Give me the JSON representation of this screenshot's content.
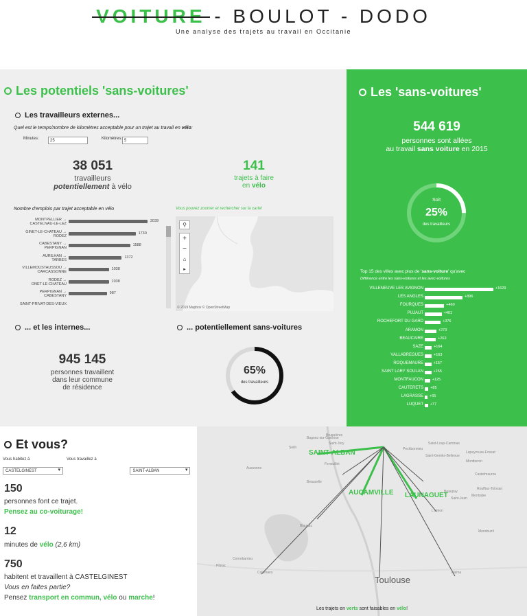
{
  "header": {
    "title_part1": "VOITURE",
    "title_part2": " - BOULOT - DODO",
    "subtitle": "Une analyse des trajets au travail en Occitanie"
  },
  "left": {
    "title": "Les potentiels 'sans-voitures'",
    "externes": {
      "title": "Les travailleurs externes...",
      "question_pre": "Quel est le temps/nombre de kilomètres acceptable pour un trajet au travail en ",
      "question_bold": "vélo",
      "question_post": ":",
      "minutes_label": "Minutes:",
      "minutes_value": "25",
      "km_label": "Kilomètres:",
      "km_value": "5",
      "workers_number": "38 051",
      "workers_l1": "travailleurs",
      "workers_l2_bold": "potentiellement",
      "workers_l2_rest": " à vélo",
      "trips_number": "141",
      "trips_l1": "trajets à faire",
      "trips_l2_pre": "en ",
      "trips_l2_bold": "vélo",
      "chart_title": "Nombre d'emplois par trajet acceptable en vélo",
      "map_hint": "Vous pouvez zoomer et rechercher sur la carte!",
      "map_credit": "© 2019 Mapbox © OpenStreetMap"
    },
    "internes": {
      "title": "... et les internes...",
      "number": "945 145",
      "l1": "personnes travaillent",
      "l2": "dans leur commune",
      "l3": "de résidence"
    },
    "potentiel": {
      "title": "... potentiellement sans-voitures",
      "pct": "65%",
      "sub": "des travailleurs"
    }
  },
  "right": {
    "title": "Les 'sans-voitures'",
    "number": "544 619",
    "l1": "personnes sont allées",
    "l2_pre": "au travail ",
    "l2_bold": "sans voiture",
    "l2_post": " en 2015",
    "donut_soit": "Soit",
    "donut_pct": "25%",
    "donut_sub": "des travailleurs",
    "top_title_pre": "Top 15 des villes avec plus de '",
    "top_title_bold": "sans-voiture",
    "top_title_post": "' qu'avec",
    "top_sub": "Différence entre les sans-voitures et les avec-voitures"
  },
  "bottom": {
    "title": "Et vous?",
    "habitez_label": "Vous habitez à",
    "habitez_value": "CASTELGINEST",
    "travaillez_label": "Vous travaillez à",
    "travaillez_value": "SAINT-ALBAN",
    "n1": "150",
    "t1": "personnes font ce trajet.",
    "t1b": "Pensez au co-voiturage!",
    "n2": "12",
    "t2_pre": "minutes de ",
    "t2_bold": "vélo",
    "t2_it": " (2,6 km)",
    "n3": "750",
    "t3": "habitent et travaillent à CASTELGINEST",
    "t3b": "Vous en faites partie?",
    "t3c_pre": "Pensez ",
    "t3c_b1": "transport en commun, vélo",
    "t3c_mid": " ou ",
    "t3c_b2": "marche",
    "t3c_post": "!"
  },
  "map2": {
    "legend_pre": "Les trajets en ",
    "legend_b1": "verts",
    "legend_mid": " sont faisables en ",
    "legend_b2": "vélo",
    "legend_post": "!",
    "green_cities": [
      "SAINT-ALBAN",
      "AUCAMVILLE",
      "LAUNAGUET"
    ],
    "big_city": "Toulouse",
    "small_cities": [
      "Bagnac-sur-Garonne",
      "Saint-Jory",
      "Bruguières",
      "Fenouillet",
      "Aussonne",
      "Seilh",
      "Saint-Geniès-Bellevue",
      "Lapeyrouse-Fossat",
      "Montberon",
      "Castelmaurou",
      "Beaupuy",
      "Rouffiac-Tolosan",
      "Saint-Loup-Cammas",
      "Saint-Jean",
      "L'Union",
      "Mondouzil",
      "Beauzelle",
      "Blagnac",
      "Cornebarrieu",
      "Pibrac",
      "Colomiers",
      "Balma",
      "Montrabe",
      "Pechbonnieu"
    ]
  },
  "chart_data": [
    {
      "type": "bar",
      "title": "Nombre d'emplois par trajet acceptable en vélo",
      "categories": [
        "MONTPELLIER → CASTELNAU-LE-LEZ",
        "GINET-LE-CHATEAU → RODEZ",
        "CABESTANY → PERPIGNAN",
        "AURILHAN → TARBES",
        "VILLEMOUSTAUSSOU → CARCASSONNE",
        "RODEZ → ONET-LE-CHATEAU",
        "PERPIGNAN → CABESTANY",
        "SAINT-PRIVAT-DES-VIEUX"
      ],
      "values": [
        2039,
        1730,
        1588,
        1372,
        1038,
        1038,
        987,
        null
      ]
    },
    {
      "type": "bar",
      "title": "Top 15 des villes avec plus de 'sans-voiture' qu'avec",
      "categories": [
        "VILLENEUVE LES AVIGNON",
        "LES ANGLES",
        "FOURQUES",
        "PUJAUT",
        "ROCHEFORT DU GARD",
        "ARAMON",
        "BEAUCAIRE",
        "SAZE",
        "VALLABREGUES",
        "ROQUEMAURE",
        "SAINT LARY SOULAN",
        "MONTFAUCON",
        "CAUTERETS",
        "LAGRASSE",
        "LUQUET"
      ],
      "values": [
        1629,
        896,
        460,
        401,
        376,
        273,
        263,
        164,
        163,
        157,
        155,
        125,
        85,
        65,
        77
      ]
    },
    {
      "type": "pie",
      "title": "Soit 25% des travailleurs",
      "values": [
        25
      ]
    },
    {
      "type": "pie",
      "title": "65% des travailleurs",
      "values": [
        65
      ]
    }
  ],
  "colors": {
    "accent": "#3dbf4b",
    "panel": "#efefef",
    "bar": "#666666"
  },
  "icons": [
    "search-icon",
    "zoom-in-icon",
    "zoom-out-icon",
    "home-icon",
    "play-icon"
  ]
}
